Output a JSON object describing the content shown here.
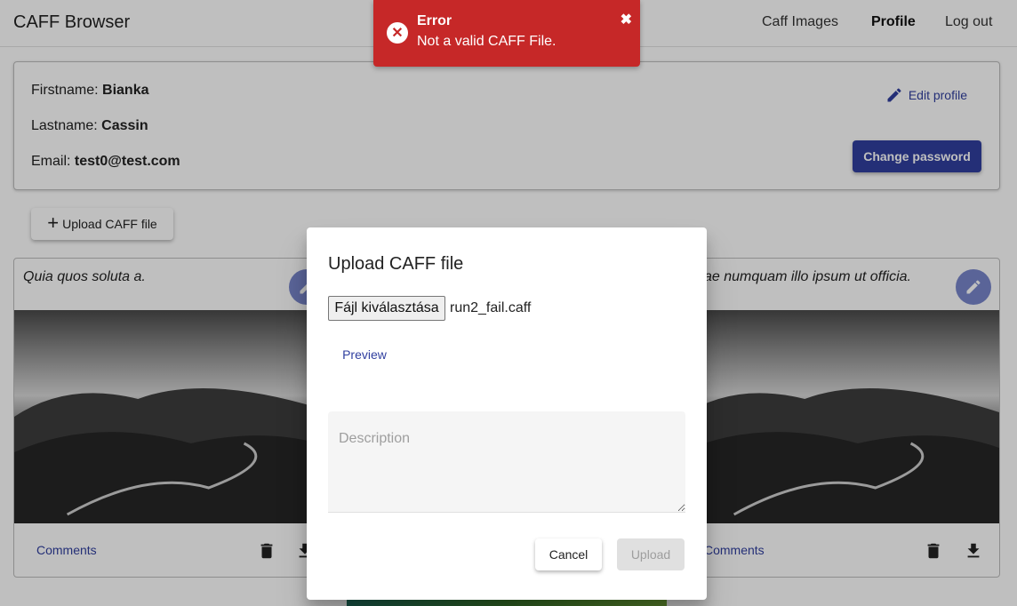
{
  "app": {
    "title": "CAFF Browser"
  },
  "nav": {
    "items": [
      "Caff Images",
      "Profile",
      "Log out"
    ]
  },
  "profile": {
    "firstname_label": "Firstname:",
    "firstname": "Bianka",
    "lastname_label": "Lastname:",
    "lastname": "Cassin",
    "email_label": "Email:",
    "email": "test0@test.com",
    "edit_label": "Edit profile",
    "change_password_label": "Change password"
  },
  "upload_caff_label": "Upload CAFF file",
  "cards": [
    {
      "description": "Quia quos soluta a.",
      "comments_label": "Comments"
    },
    {
      "description": "ae numquam illo ipsum ut officia.",
      "comments_label": "Comments"
    }
  ],
  "dialog": {
    "title": "Upload CAFF file",
    "choose_file_label": "Fájl kiválasztása",
    "file_name": "run2_fail.caff",
    "preview_label": "Preview",
    "description_placeholder": "Description",
    "cancel_label": "Cancel",
    "upload_label": "Upload"
  },
  "toast": {
    "title": "Error",
    "message": "Not a valid CAFF File.",
    "color": "#c62828"
  },
  "colors": {
    "primary": "#303f9f",
    "error": "#c62828"
  },
  "icons": [
    "pencil-icon",
    "delete-icon",
    "download-icon",
    "error-circle-icon",
    "close-icon",
    "plus-icon"
  ]
}
